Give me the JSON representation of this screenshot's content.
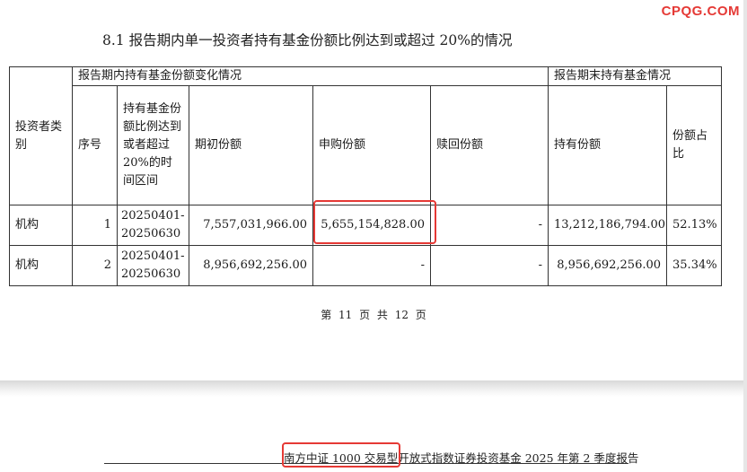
{
  "watermark": "CPQG.COM",
  "section_title": "8.1 报告期内单一投资者持有基金份额比例达到或超过 20%的情况",
  "table": {
    "group_headers": {
      "investor_type": "投资者类别",
      "during_period": "报告期内持有基金份额变化情况",
      "period_end": "报告期末持有基金情况"
    },
    "column_headers": {
      "seq": "序号",
      "period": "持有基金份额比例达到或者超过 20%的时间区间",
      "opening_shares": "期初份额",
      "subscription_shares": "申购份额",
      "redemption_shares": "赎回份额",
      "held_shares": "持有份额",
      "share_ratio": "份额占比"
    },
    "rows": [
      {
        "investor_type": "机构",
        "seq": "1",
        "period": "20250401-20250630",
        "opening_shares": "7,557,031,966.00",
        "subscription_shares": "5,655,154,828.00",
        "redemption_shares": "-",
        "held_shares": "13,212,186,794.00",
        "share_ratio": "52.13%"
      },
      {
        "investor_type": "机构",
        "seq": "2",
        "period": "20250401-20250630",
        "opening_shares": "8,956,692,256.00",
        "subscription_shares": "-",
        "redemption_shares": "-",
        "held_shares": "8,956,692,256.00",
        "share_ratio": "35.34%"
      }
    ]
  },
  "page_footer": "第 11 页 共 12 页",
  "next_page_header": "南方中证 1000 交易型开放式指数证券投资基金 2025 年第 2 季度报告",
  "highlight_color": "#e53935"
}
